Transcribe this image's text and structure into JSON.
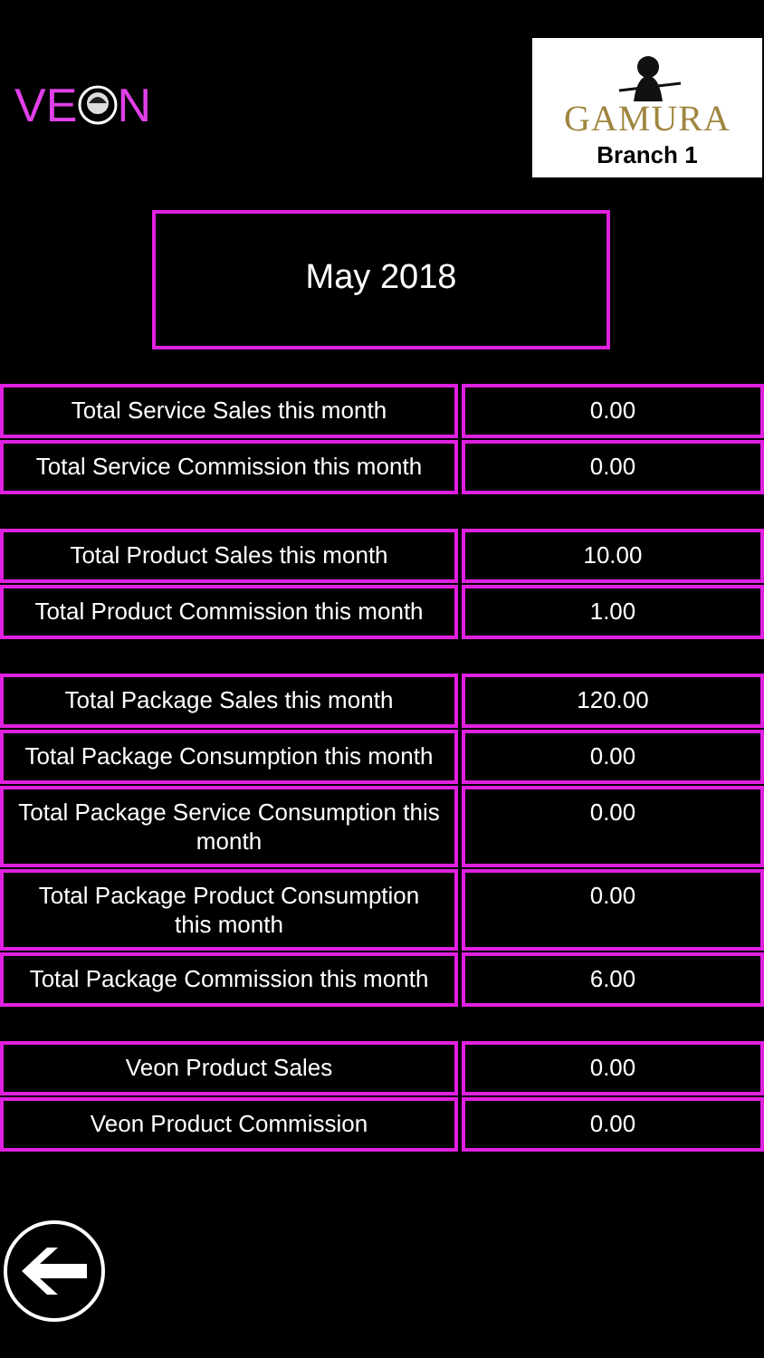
{
  "brand_logo": {
    "text_before": "VE",
    "text_after": "N"
  },
  "branch_logo": {
    "name": "GAMURA",
    "branch": "Branch 1"
  },
  "month": "May 2018",
  "groups": [
    {
      "rows": [
        {
          "label": "Total Service Sales this month",
          "value": "0.00"
        },
        {
          "label": "Total Service Commission this month",
          "value": "0.00"
        }
      ]
    },
    {
      "rows": [
        {
          "label": "Total Product Sales this month",
          "value": "10.00"
        },
        {
          "label": "Total Product Commission this month",
          "value": "1.00"
        }
      ]
    },
    {
      "rows": [
        {
          "label": "Total Package Sales this month",
          "value": "120.00"
        },
        {
          "label": "Total Package Consumption this month",
          "value": "0.00"
        },
        {
          "label": "Total Package Service Consumption this month",
          "value": "0.00"
        },
        {
          "label": "Total Package Product Consumption this month",
          "value": "0.00"
        },
        {
          "label": "Total Package Commission this month",
          "value": "6.00"
        }
      ]
    },
    {
      "rows": [
        {
          "label": "Veon Product Sales",
          "value": "0.00"
        },
        {
          "label": "Veon Product Commission",
          "value": "0.00"
        }
      ]
    }
  ]
}
